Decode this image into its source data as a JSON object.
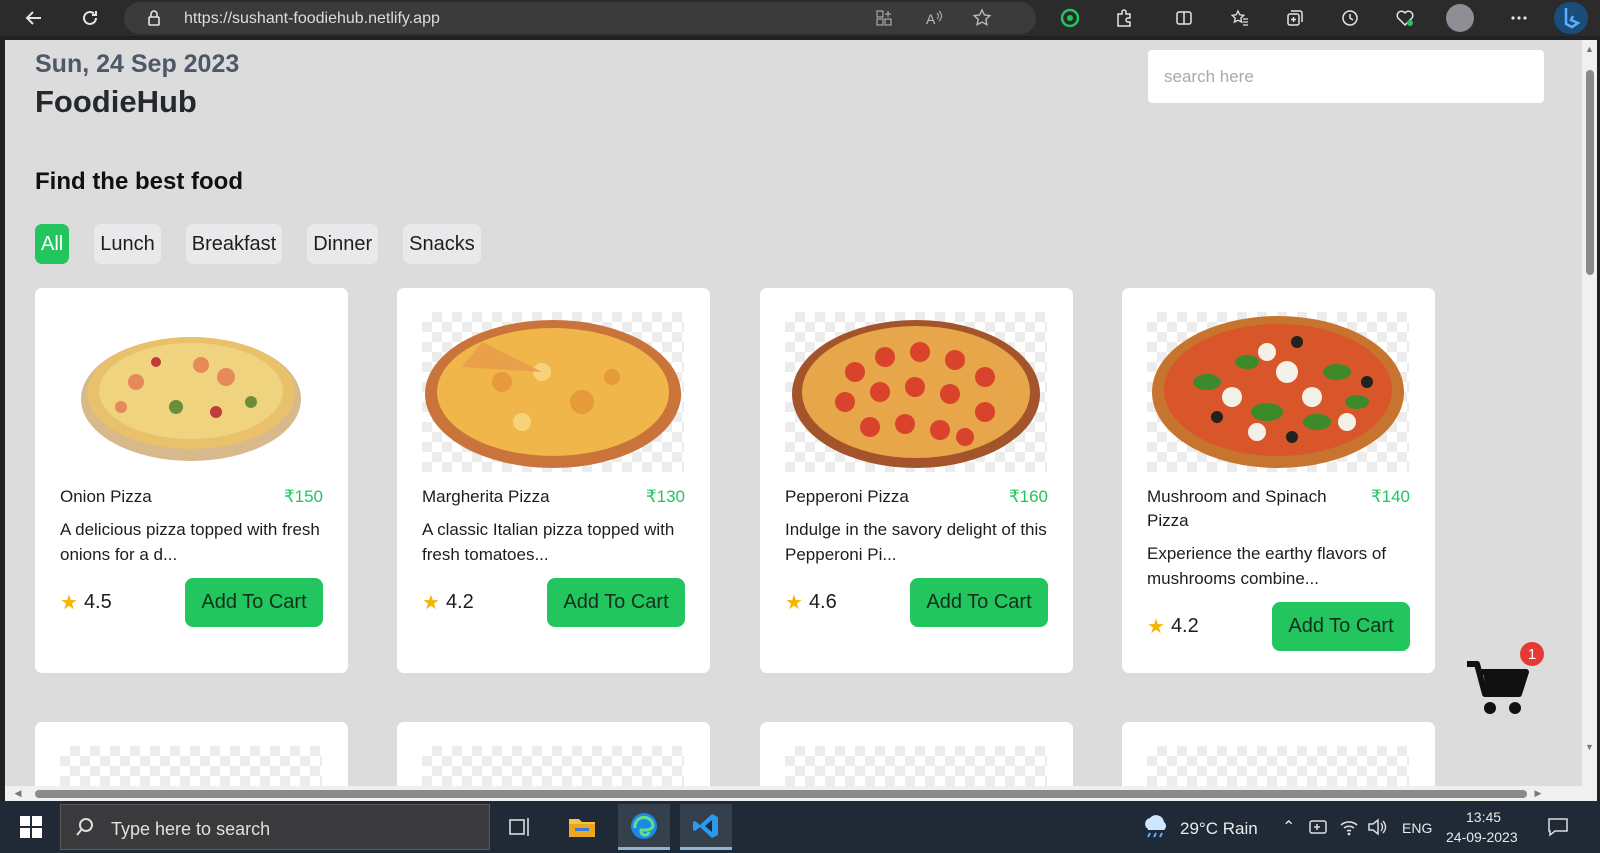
{
  "browser": {
    "url": "https://sushant-foodiehub.netlify.app"
  },
  "page": {
    "date": "Sun, 24 Sep 2023",
    "brand": "FoodieHub",
    "search_placeholder": "search here",
    "heading": "Find the best food",
    "filters": [
      "All",
      "Lunch",
      "Breakfast",
      "Dinner",
      "Snacks"
    ],
    "active_filter": "All",
    "add_to_cart_label": "Add To Cart",
    "cart_count": "1",
    "accent_color": "#22c55e",
    "products": [
      {
        "name": "Onion Pizza",
        "price": "₹150",
        "description": "A delicious pizza topped with fresh onions for a d...",
        "rating": "4.5"
      },
      {
        "name": "Margherita Pizza",
        "price": "₹130",
        "description": "A classic Italian pizza topped with fresh tomatoes...",
        "rating": "4.2"
      },
      {
        "name": "Pepperoni Pizza",
        "price": "₹160",
        "description": "Indulge in the savory delight of this Pepperoni Pi...",
        "rating": "4.6"
      },
      {
        "name": "Mushroom and Spinach Pizza",
        "price": "₹140",
        "description": "Experience the earthy flavors of mushrooms combine...",
        "rating": "4.2"
      }
    ]
  },
  "taskbar": {
    "search_placeholder": "Type here to search",
    "weather": "29°C  Rain",
    "language": "ENG",
    "time": "13:45",
    "date": "24-09-2023"
  }
}
